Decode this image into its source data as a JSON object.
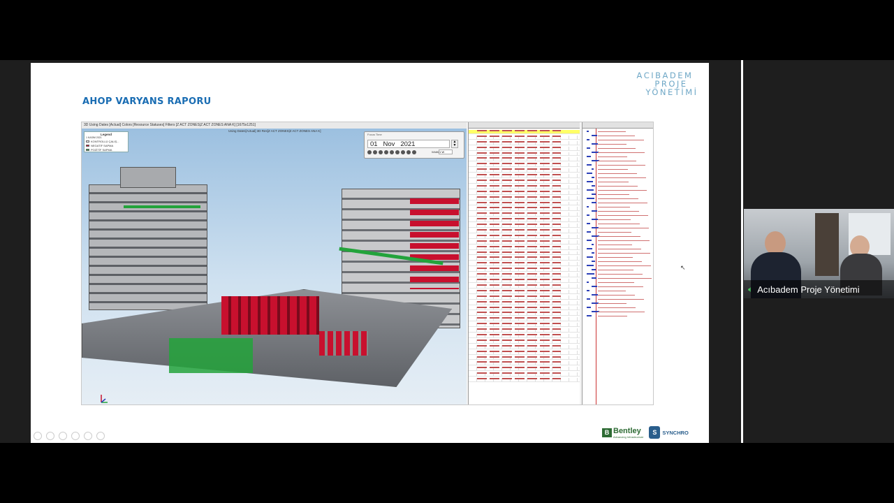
{
  "slide": {
    "title": "AHOP VARYANS RAPORU",
    "logo_lines": [
      "ACIBADEM",
      "PROJE",
      "YÖNETİMİ"
    ],
    "brands": {
      "bentley": "Bentley",
      "bentley_tagline": "Advancing Infrastructure",
      "synchro": "SYNCHRO"
    }
  },
  "app": {
    "title_bar": "3D Using Dates [Actual] Colors [Resource Statuses] Filters [Z ACT ZONES|Z ACT ZONES ANA K]  [1675x1251]",
    "view_subtitle": "Using Dates[Actual] 3D Res[Z ACT ZONES|Z ACT ZONES ANA K]",
    "legend": {
      "title": "Legend",
      "date": "1 KASIM 2021",
      "items": [
        {
          "label": "KONTROLLÜ ÇALIŞ...",
          "color": "#ffffff"
        },
        {
          "label": "NEGATİF SAPMA",
          "color": "#c8102e"
        },
        {
          "label": "POZİTİF SAPMA",
          "color": "#23a33b"
        }
      ]
    },
    "date_control": {
      "label": "Focus Time",
      "day": "01",
      "month": "Nov",
      "year": "2021",
      "width_label": "Width",
      "width_value": "1 W"
    }
  },
  "meeting": {
    "participant_name": "Acıbadem Proje Yönetimi",
    "mic_icon": "speaker-icon"
  },
  "colors": {
    "title_blue": "#1a6db3",
    "variance_negative": "#c8102e",
    "variance_positive": "#23a33b",
    "gantt_bar": "#2b3fb8"
  }
}
